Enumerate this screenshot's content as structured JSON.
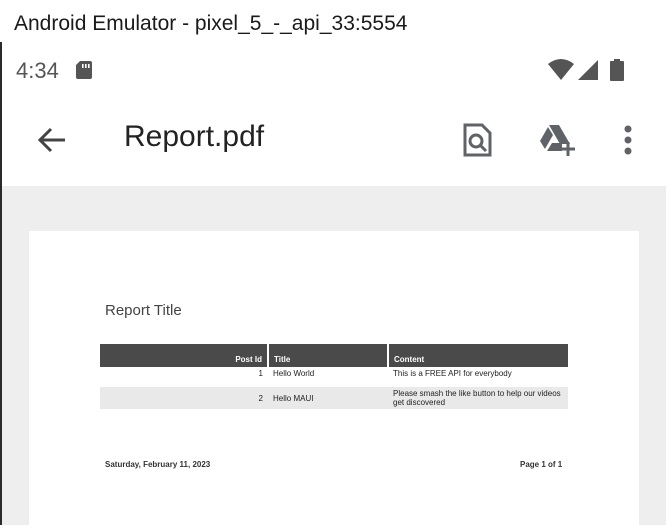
{
  "window": {
    "title": "Android Emulator - pixel_5_-_api_33:5554"
  },
  "status_bar": {
    "time": "4:34",
    "icons": [
      "sd-card-icon",
      "wifi-icon",
      "signal-icon",
      "battery-icon"
    ]
  },
  "app_bar": {
    "title": "Report.pdf",
    "icons": [
      "back-arrow-icon",
      "search-document-icon",
      "add-to-drive-icon",
      "more-vert-icon"
    ]
  },
  "report": {
    "title": "Report Title",
    "columns": [
      "Post Id",
      "Title",
      "Content"
    ],
    "rows": [
      {
        "id": "1",
        "title": "Hello World",
        "content": "This is a FREE API for everybody"
      },
      {
        "id": "2",
        "title": "Hello MAUI",
        "content": "Please smash the like button to help our videos get discovered"
      }
    ],
    "footer_date": "Saturday, February 11, 2023",
    "footer_page": "Page 1 of 1"
  },
  "colors": {
    "icon": "#5f6368",
    "table_header": "#4a4a4a",
    "row_alt": "#e9e9e9",
    "viewer_bg": "#eeeeee"
  }
}
